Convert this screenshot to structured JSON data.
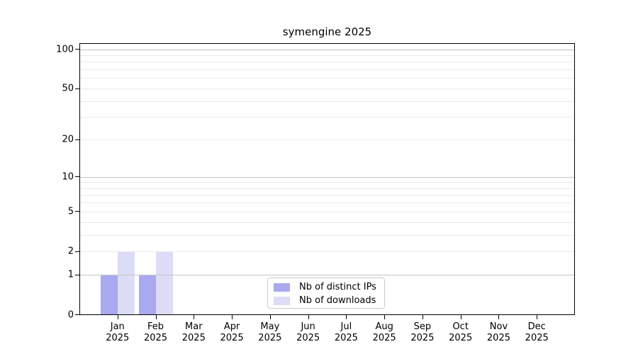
{
  "figure": {
    "title": "symengine 2025"
  },
  "chart_data": {
    "type": "bar",
    "title": "symengine 2025",
    "categories": [
      "Jan",
      "Feb",
      "Mar",
      "Apr",
      "May",
      "Jun",
      "Jul",
      "Aug",
      "Sep",
      "Oct",
      "Nov",
      "Dec"
    ],
    "category_year": "2025",
    "series": [
      {
        "name": "Nb of distinct IPs",
        "color": "#a9a9ef",
        "values": [
          1,
          1,
          0,
          0,
          0,
          0,
          0,
          0,
          0,
          0,
          0,
          0
        ]
      },
      {
        "name": "Nb of downloads",
        "color": "#dcdcf7",
        "values": [
          2,
          2,
          0,
          0,
          0,
          0,
          0,
          0,
          0,
          0,
          0,
          0
        ]
      }
    ],
    "xlabel": "",
    "ylabel": "",
    "y_scale": "log1p",
    "y_ticks": [
      0,
      1,
      2,
      5,
      10,
      20,
      50,
      100
    ],
    "ylim": [
      0,
      111
    ],
    "grid": {
      "on": true,
      "minor_values": [
        2,
        3,
        4,
        5,
        6,
        7,
        8,
        9,
        20,
        30,
        40,
        50,
        60,
        70,
        80,
        90
      ],
      "decade_values": [
        1,
        10,
        100
      ]
    },
    "legend": {
      "position": "inside-bottom-center"
    },
    "colors": {
      "grid_minor": "#e9e9e9",
      "grid_decade": "#c3c3c3",
      "spine": "#000000",
      "background": "#ffffff",
      "text": "#000000",
      "legend_border": "#cccccc"
    }
  }
}
